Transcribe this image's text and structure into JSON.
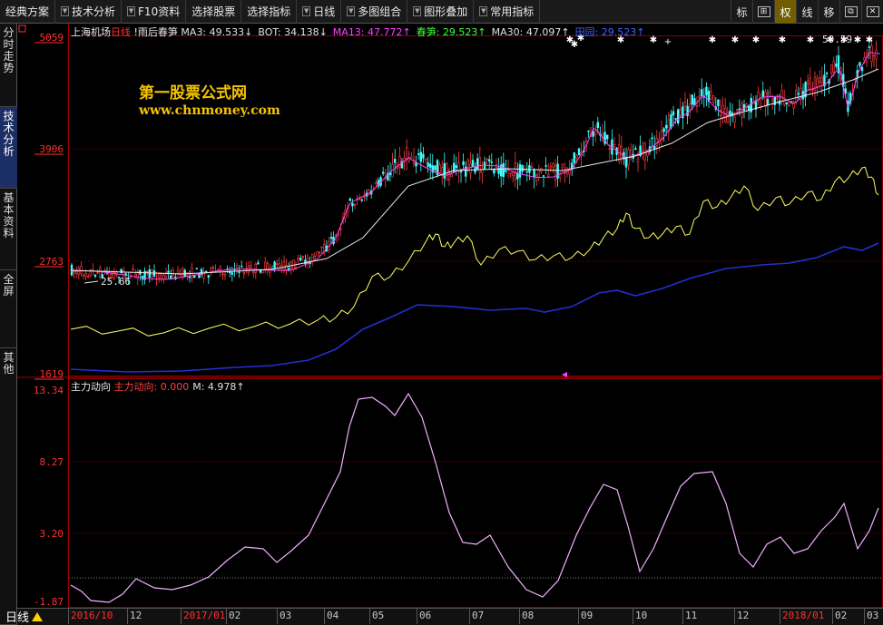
{
  "toolbar": {
    "items": [
      {
        "label": "经典方案",
        "has_dropdown": false
      },
      {
        "label": "技术分析",
        "has_dropdown": true
      },
      {
        "label": "F10资料",
        "has_dropdown": true
      },
      {
        "label": "选择股票",
        "has_dropdown": false
      },
      {
        "label": "选择指标",
        "has_dropdown": false
      },
      {
        "label": "日线",
        "has_dropdown": true
      },
      {
        "label": "多图组合",
        "has_dropdown": true
      },
      {
        "label": "图形叠加",
        "has_dropdown": true
      },
      {
        "label": "常用指标",
        "has_dropdown": true
      }
    ],
    "right_buttons": [
      {
        "label": "标",
        "active": false
      },
      {
        "label": "⊞",
        "active": false
      },
      {
        "label": "权",
        "active": true
      },
      {
        "label": "线",
        "active": false
      },
      {
        "label": "移",
        "active": false
      },
      {
        "label": "⧉",
        "active": false
      },
      {
        "label": "✕",
        "active": false
      }
    ]
  },
  "sidebar": {
    "tabs": [
      {
        "label": "分时走势",
        "active": false
      },
      {
        "label": "技术分析",
        "active": true
      },
      {
        "label": "基本资料",
        "active": false
      },
      {
        "label": "全屏",
        "active": false
      },
      {
        "label": "其他",
        "active": false
      }
    ]
  },
  "main_header": {
    "stock_name": "上海机场",
    "period": "日线",
    "indicator": "雨后春笋",
    "fields": [
      {
        "label": "MA3: 49.533",
        "arrow": "↓",
        "color": "#e0e0e0"
      },
      {
        "label": "BOT: 34.138",
        "arrow": "↓",
        "color": "#e0e0e0"
      },
      {
        "label": "MA13: 47.772",
        "arrow": "↑",
        "color": "#ff40ff"
      },
      {
        "label": "春笋: 29.523",
        "arrow": "↑",
        "color": "#40ff40"
      },
      {
        "label": "MA30: 47.097",
        "arrow": "↑",
        "color": "#e0e0e0"
      },
      {
        "label": "田园: 29.523",
        "arrow": "↑",
        "color": "#4060ff"
      }
    ]
  },
  "watermark": {
    "title": "第一股票公式网",
    "url": "www.chnmoney.com"
  },
  "main_chart": {
    "y_labels": [
      "5059",
      "3906",
      "2763",
      "1619"
    ],
    "annotations": {
      "high": "50.59",
      "low": "25.66"
    }
  },
  "sub_header": {
    "name": "主力动向",
    "fields": [
      {
        "label": "主力动向: 0.000",
        "color": "#ff4040"
      },
      {
        "label": "M: 4.978",
        "color": "#e0e0e0",
        "arrow": "↑"
      }
    ]
  },
  "sub_chart": {
    "y_labels": [
      "13.34",
      "8.27",
      "3.20",
      "-1.87"
    ]
  },
  "bottom": {
    "period_label": "日线",
    "x_ticks": [
      {
        "label": "2016/10",
        "red": true
      },
      {
        "label": "12",
        "red": false
      },
      {
        "label": "2017/01",
        "red": true
      },
      {
        "label": "02",
        "red": false
      },
      {
        "label": "03",
        "red": false
      },
      {
        "label": "04",
        "red": false
      },
      {
        "label": "05",
        "red": false
      },
      {
        "label": "06",
        "red": false
      },
      {
        "label": "07",
        "red": false
      },
      {
        "label": "08",
        "red": false
      },
      {
        "label": "09",
        "red": false
      },
      {
        "label": "10",
        "red": false
      },
      {
        "label": "11",
        "red": false
      },
      {
        "label": "12",
        "red": false
      },
      {
        "label": "2018/01",
        "red": true
      },
      {
        "label": "02",
        "red": false
      },
      {
        "label": "03",
        "red": false
      }
    ]
  },
  "colors": {
    "up": "#ff3c3c",
    "down": "#40ffff",
    "ma_white": "#e8e8e8",
    "ma_magenta": "#ff40ff",
    "yellow": "#ffff60",
    "blue": "#2030d0",
    "sub_line": "#f0b0ff"
  }
}
